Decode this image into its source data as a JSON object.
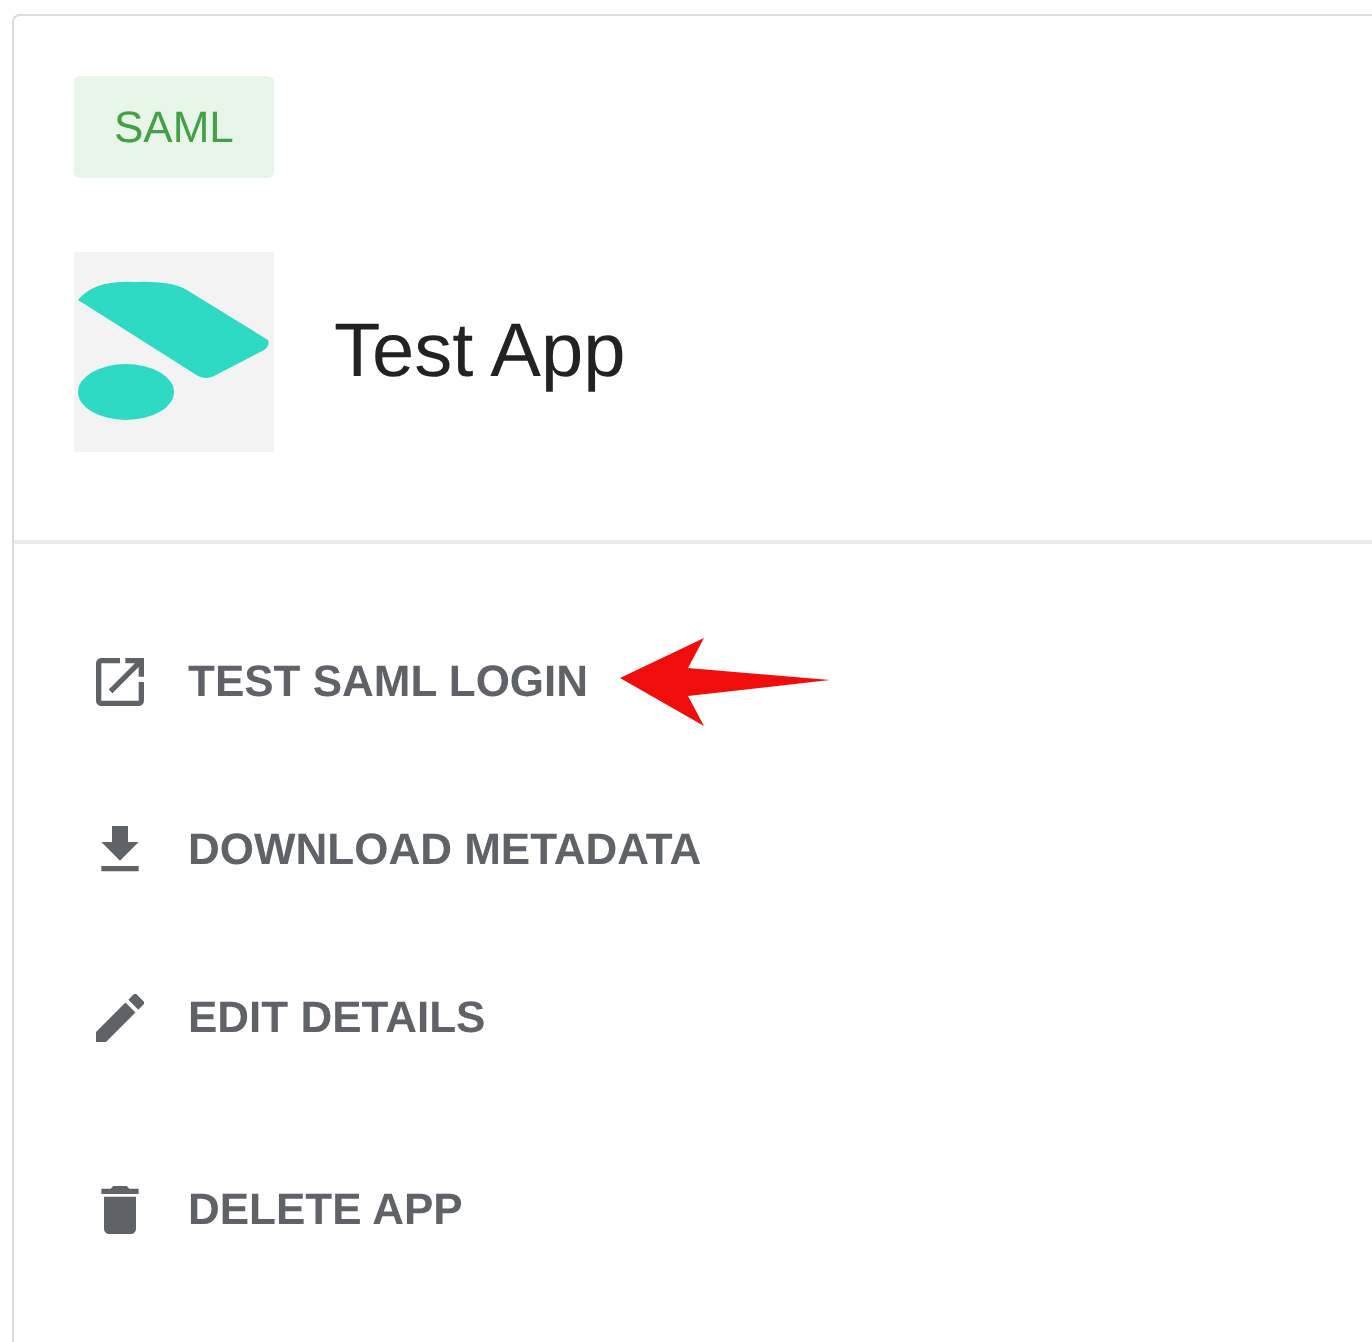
{
  "app": {
    "badge": "SAML",
    "title": "Test App"
  },
  "actions": [
    {
      "kind": "open",
      "label": "TEST SAML LOGIN",
      "highlighted": true
    },
    {
      "kind": "download",
      "label": "DOWNLOAD METADATA",
      "highlighted": false
    },
    {
      "kind": "edit",
      "label": "EDIT DETAILS",
      "highlighted": false
    },
    {
      "kind": "delete",
      "label": "DELETE APP",
      "highlighted": false
    }
  ]
}
